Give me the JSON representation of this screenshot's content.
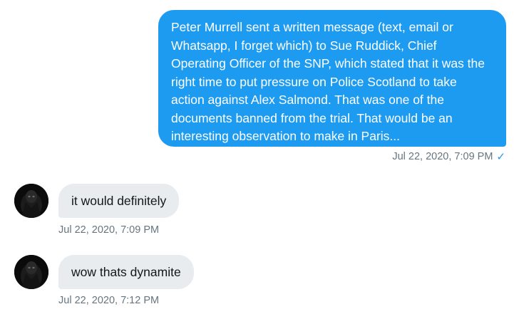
{
  "messages": {
    "sent": {
      "text": "Peter Murrell sent a written message (text, email or Whatsapp, I forget which) to Sue Ruddick, Chief Operating Officer of the SNP, which stated that it was the right time to put pressure on Police Scotland to take action against Alex Salmond. That was one of the documents banned from the trial. That would be an interesting observation to make in Paris...",
      "timestamp": "Jul 22, 2020, 7:09 PM",
      "status_icon": "checkmark-icon"
    },
    "received": [
      {
        "text": "it would definitely",
        "timestamp": "Jul 22, 2020, 7:09 PM",
        "avatar_icon": "avatar-image"
      },
      {
        "text": "wow thats dynamite",
        "timestamp": "Jul 22, 2020, 7:12 PM",
        "avatar_icon": "avatar-image"
      }
    ]
  },
  "colors": {
    "sent_bubble": "#1d9bf0",
    "received_bubble": "#e8ecef",
    "meta_text": "#66757f"
  }
}
